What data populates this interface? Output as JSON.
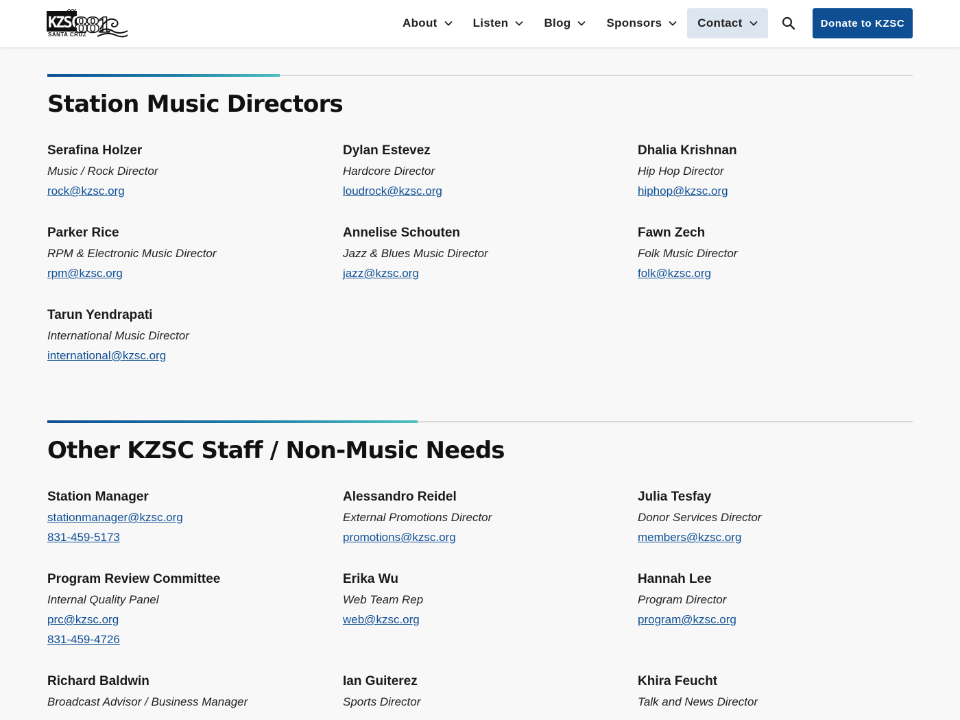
{
  "header": {
    "logo_text": "KZSC 88.1 SANTA CRUZ",
    "nav": [
      {
        "label": "About",
        "active": false
      },
      {
        "label": "Listen",
        "active": false
      },
      {
        "label": "Blog",
        "active": false
      },
      {
        "label": "Sponsors",
        "active": false
      },
      {
        "label": "Contact",
        "active": true
      }
    ],
    "search_icon": "search-icon",
    "donate_label": "Donate to KZSC"
  },
  "colors": {
    "brand": "#0e4f94",
    "link": "#0e4f94",
    "accent_gradient": [
      "#0e4f94",
      "#4ec0c2"
    ],
    "nav_active_bg": "#dde6f0"
  },
  "sections": [
    {
      "title": "Station Music Directors",
      "people": [
        {
          "name": "Serafina Holzer",
          "role": "Music / Rock Director",
          "links": [
            "rock@kzsc.org"
          ]
        },
        {
          "name": "Dylan Estevez",
          "role": "Hardcore Director",
          "links": [
            "loudrock@kzsc.org"
          ]
        },
        {
          "name": "Dhalia Krishnan",
          "role": "Hip Hop Director",
          "links": [
            "hiphop@kzsc.org"
          ]
        },
        {
          "name": "Parker Rice",
          "role": "RPM & Electronic Music Director",
          "links": [
            "rpm@kzsc.org"
          ]
        },
        {
          "name": "Annelise Schouten",
          "role": "Jazz & Blues Music Director",
          "links": [
            "jazz@kzsc.org"
          ]
        },
        {
          "name": "Fawn Zech",
          "role": "Folk Music Director",
          "links": [
            "folk@kzsc.org"
          ]
        },
        {
          "name": "Tarun Yendrapati",
          "role": "International Music Director",
          "links": [
            "international@kzsc.org"
          ]
        }
      ]
    },
    {
      "title": "Other KZSC Staff / Non-Music Needs",
      "people": [
        {
          "name": "Station Manager",
          "role": "",
          "links": [
            "stationmanager@kzsc.org",
            "831-459-5173"
          ]
        },
        {
          "name": "Alessandro Reidel",
          "role": "External Promotions Director",
          "links": [
            "promotions@kzsc.org"
          ]
        },
        {
          "name": "Julia Tesfay",
          "role": "Donor Services Director",
          "links": [
            "members@kzsc.org"
          ]
        },
        {
          "name": "Program Review Committee",
          "role": "Internal Quality Panel",
          "links": [
            "prc@kzsc.org",
            "831-459-4726"
          ]
        },
        {
          "name": "Erika Wu",
          "role": "Web Team Rep",
          "links": [
            "web@kzsc.org"
          ]
        },
        {
          "name": "Hannah Lee",
          "role": "Program Director",
          "links": [
            "program@kzsc.org"
          ]
        },
        {
          "name": "Richard Baldwin",
          "role": "Broadcast Advisor / Business Manager",
          "links": []
        },
        {
          "name": "Ian Guiterez",
          "role": "Sports Director",
          "links": []
        },
        {
          "name": "Khira Feucht",
          "role": "Talk and News Director",
          "links": []
        }
      ]
    }
  ]
}
